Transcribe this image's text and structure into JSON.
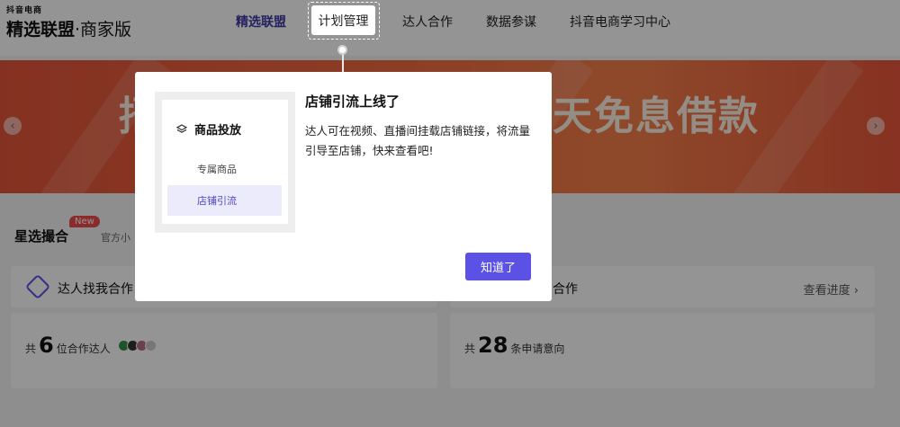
{
  "logo": {
    "small": "抖音电商",
    "main": "精选联盟",
    "suffix": "·商家版"
  },
  "nav": {
    "items": [
      {
        "label": "精选联盟"
      },
      {
        "label": "计划管理"
      },
      {
        "label": "达人合作"
      },
      {
        "label": "数据参谋"
      },
      {
        "label": "抖音电商学习中心"
      }
    ]
  },
  "banner": {
    "left_char": "招",
    "text": "天免息借款"
  },
  "section": {
    "title": "星选撮合",
    "badge": "New",
    "subtitle": "官方小"
  },
  "cards": {
    "left": {
      "header": "达人找我合作",
      "prefix": "共",
      "count": "6",
      "suffix": "位合作达人"
    },
    "right": {
      "header": "合作",
      "link": "查看进度 ›",
      "prefix": "共",
      "count": "28",
      "suffix": "条申请意向"
    }
  },
  "modal": {
    "preview": {
      "group": "商品投放",
      "item1": "专属商品",
      "item2": "店铺引流"
    },
    "title": "店铺引流上线了",
    "description": "达人可在视频、直播间挂载店铺链接，将流量引导至店铺，快来查看吧!",
    "button": "知道了"
  },
  "colors": {
    "accent": "#5b52e5",
    "banner": "#f0683f",
    "badge": "#ef4d4d"
  }
}
